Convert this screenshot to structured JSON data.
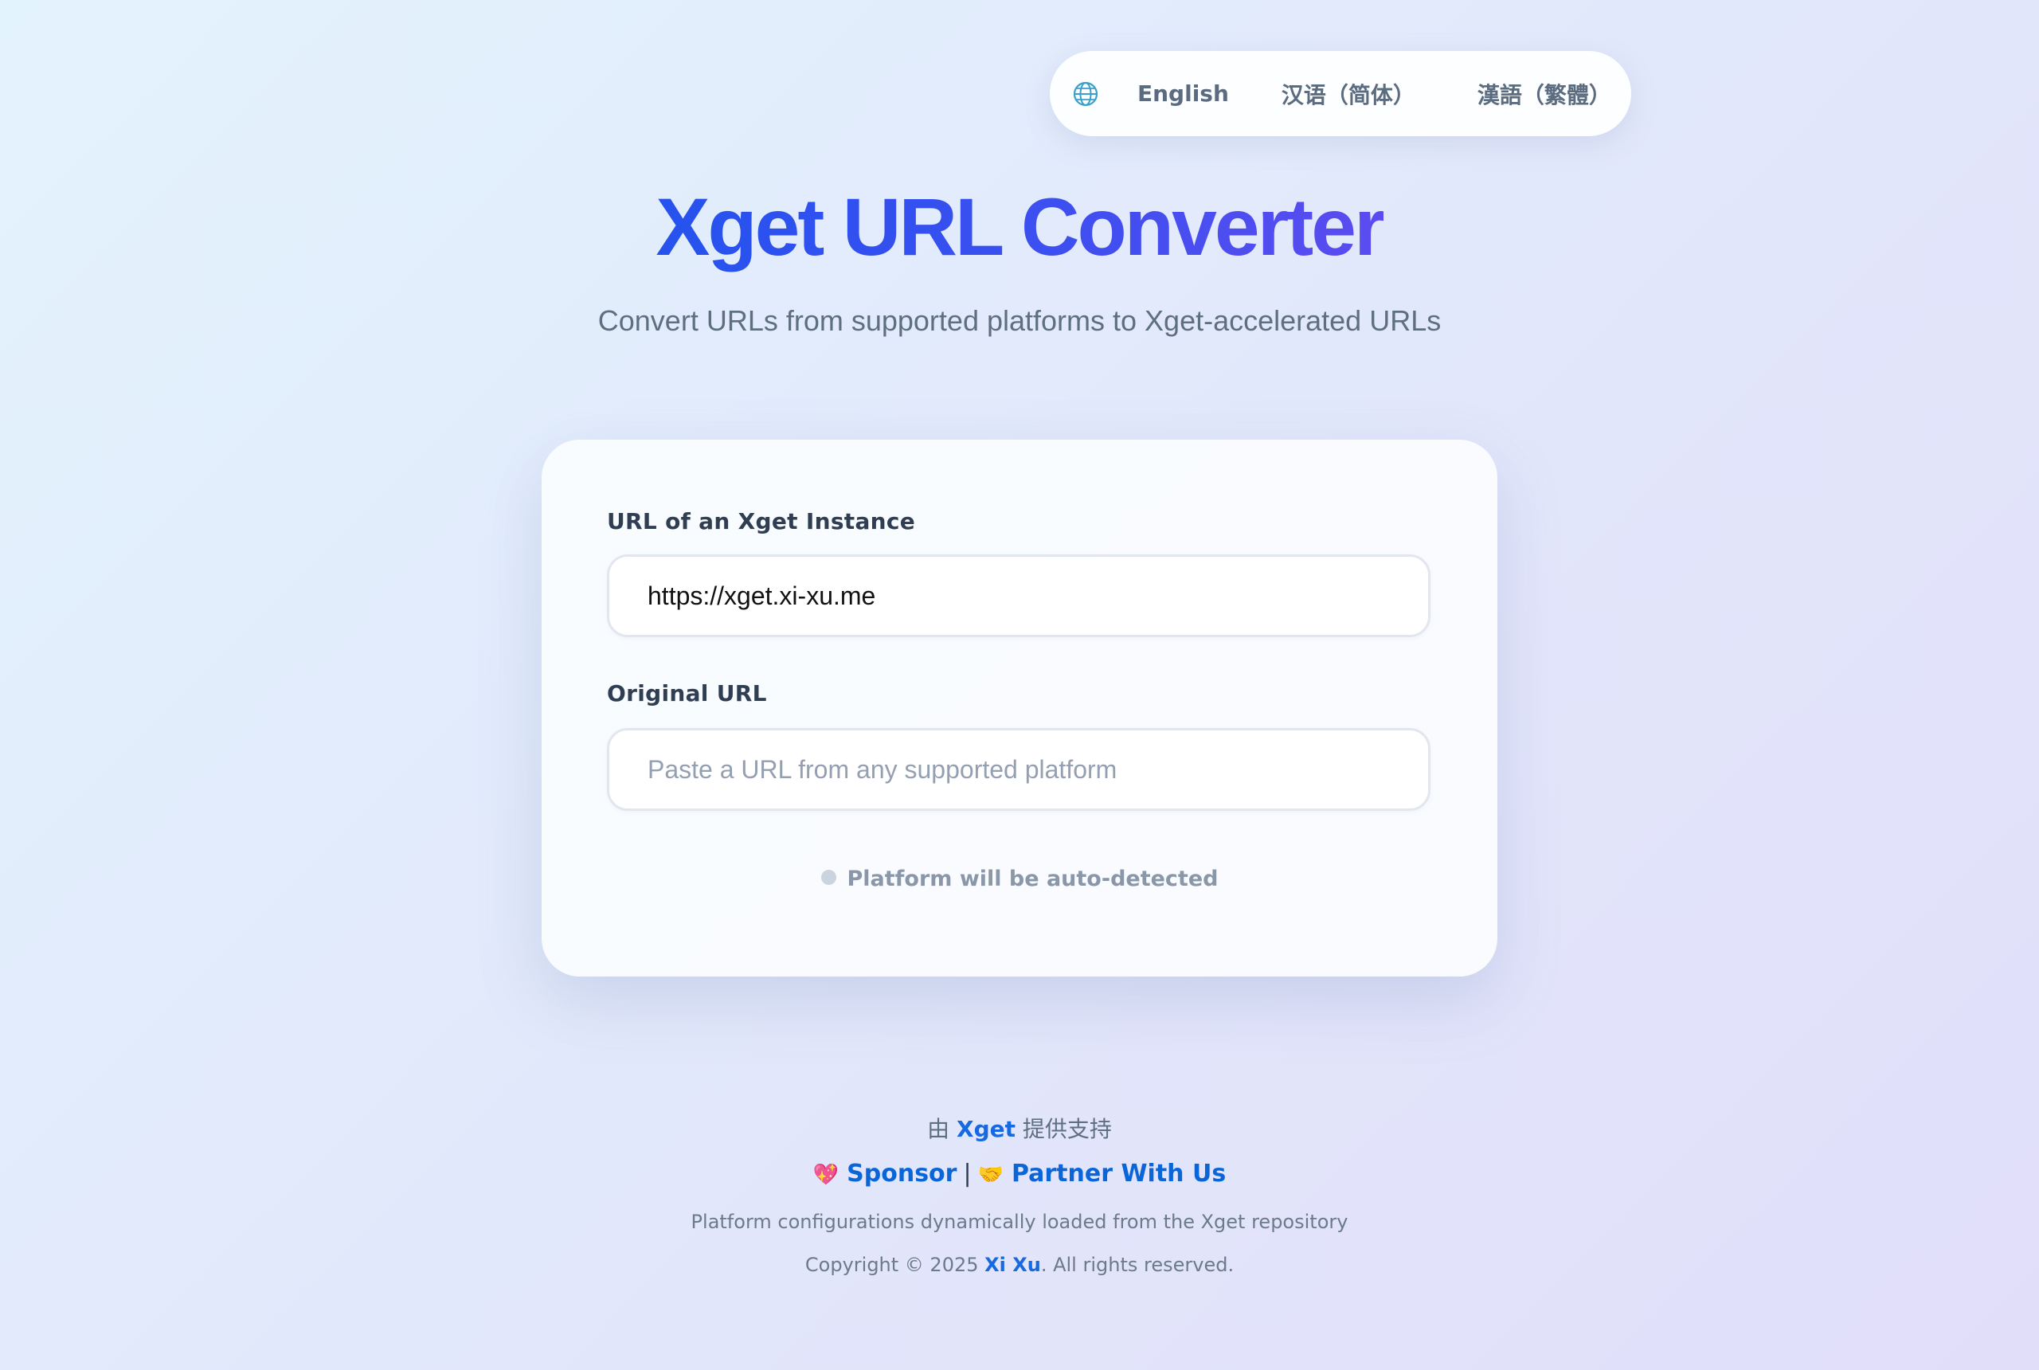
{
  "language_switcher": {
    "options": [
      {
        "label": "English"
      },
      {
        "label": "汉语（简体）"
      },
      {
        "label": "漢語（繁體）"
      }
    ]
  },
  "header": {
    "title": "Xget URL Converter",
    "subtitle": "Convert URLs from supported platforms to Xget-accelerated URLs"
  },
  "form": {
    "instance_label": "URL of an Xget Instance",
    "instance_value": "https://xget.xi-xu.me",
    "original_label": "Original URL",
    "original_value": "",
    "original_placeholder": "Paste a URL from any supported platform",
    "status_text": "Platform will be auto-detected"
  },
  "footer": {
    "powered_prefix": "由 ",
    "powered_link": "Xget",
    "powered_suffix": " 提供支持",
    "sponsor_emoji": "💖",
    "sponsor_label": "Sponsor",
    "separator": "|",
    "partner_emoji": "🤝",
    "partner_label": "Partner With Us",
    "config_note": "Platform configurations dynamically loaded from the Xget repository",
    "copyright_prefix": "Copyright © 2025 ",
    "copyright_author": "Xi Xu",
    "copyright_suffix": ". All rights reserved."
  },
  "colors": {
    "accent_link": "#1669e0",
    "title_gradient_start": "#2552ee",
    "title_gradient_end": "#5b4cf0",
    "globe_icon": "#3aa0c8"
  }
}
